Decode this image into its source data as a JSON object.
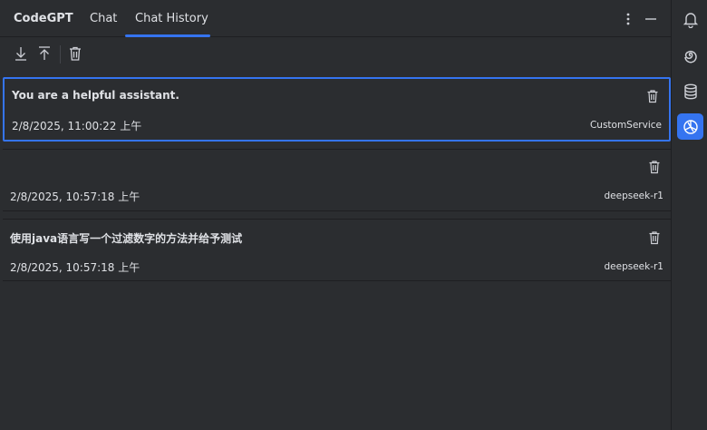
{
  "header": {
    "app_title": "CodeGPT",
    "tabs": [
      {
        "label": "Chat",
        "active": false
      },
      {
        "label": "Chat History",
        "active": true
      }
    ],
    "accent_color": "#3574f0"
  },
  "toolbar": {
    "icons": [
      "import-icon",
      "export-icon",
      "trash-icon"
    ]
  },
  "history": [
    {
      "title": "You are a helpful assistant.",
      "date": "2/8/2025, 11:00:22 上午",
      "model": "CustomService",
      "selected": true
    },
    {
      "title": "",
      "date": "2/8/2025, 10:57:18 上午",
      "model": "deepseek-r1",
      "selected": false
    },
    {
      "title": "使用java语言写一个过滤数字的方法并给予测试",
      "date": "2/8/2025, 10:57:18 上午",
      "model": "deepseek-r1",
      "selected": false
    }
  ],
  "rightbar": {
    "icons": [
      "notifications-icon",
      "ai-spiral-icon",
      "database-icon",
      "codegpt-icon"
    ],
    "active": "codegpt-icon"
  }
}
